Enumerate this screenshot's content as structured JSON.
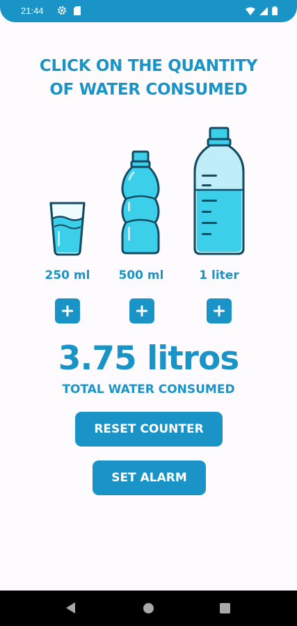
{
  "status_bar": {
    "time": "21:44",
    "icons": [
      "gear-icon",
      "sd-card-icon",
      "wifi-icon",
      "signal-icon",
      "battery-icon"
    ]
  },
  "title": {
    "line1": "CLICK ON THE QUANTITY",
    "line2": "OF WATER CONSUMED"
  },
  "options": [
    {
      "label": "250 ml",
      "icon": "glass-icon"
    },
    {
      "label": "500 ml",
      "icon": "small-bottle-icon"
    },
    {
      "label": "1 liter",
      "icon": "large-bottle-icon"
    }
  ],
  "total": {
    "value": "3.75 litros",
    "label": "TOTAL WATER CONSUMED"
  },
  "buttons": {
    "reset": "RESET COUNTER",
    "alarm": "SET ALARM"
  },
  "colors": {
    "accent": "#1a94c7",
    "water_light": "#bfeef9",
    "water": "#3ccfea",
    "outline": "#144a63",
    "background": "#fdfbfe"
  }
}
